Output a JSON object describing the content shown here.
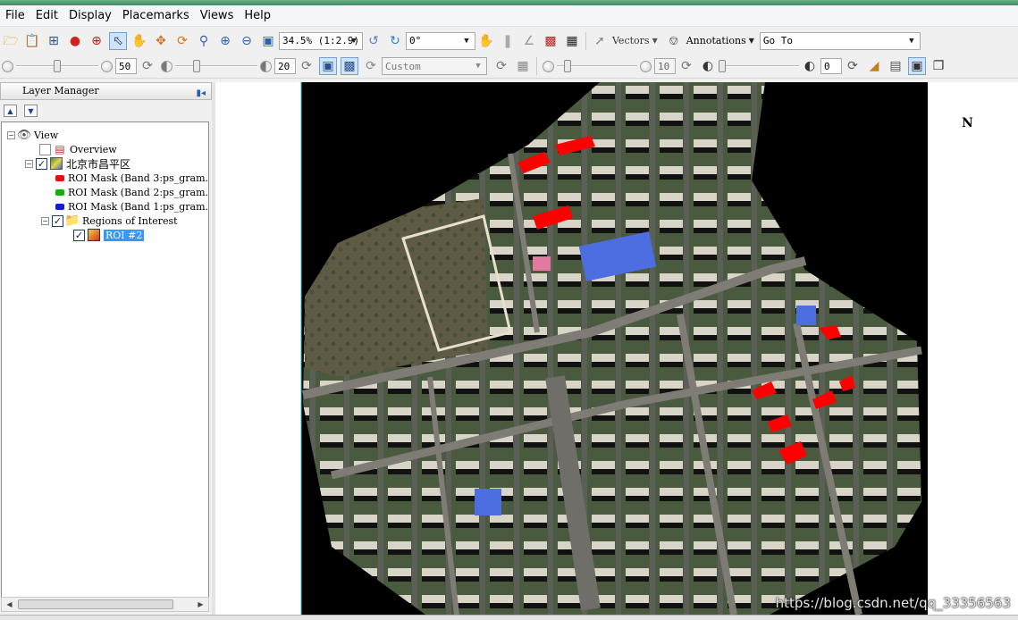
{
  "menu": [
    "File",
    "Edit",
    "Display",
    "Placemarks",
    "Views",
    "Help"
  ],
  "toolbar1": {
    "zoom_value": "34.5% (1:2.9)",
    "rotation_value": "0°",
    "vectors_label": "Vectors",
    "annotations_label": "Annotations",
    "goto_value": "Go To"
  },
  "toolbar2": {
    "brightness_value": "50",
    "contrast_value": "20",
    "stretch_value": "Custom",
    "transparency_value": "0",
    "sharpen_value": "10"
  },
  "layer_manager": {
    "title": "Layer Manager",
    "tree": {
      "view_label": "View",
      "overview_label": "Overview",
      "raster_label": "北京市昌平区",
      "bands": [
        {
          "label": "ROI Mask (Band 3:ps_gram.",
          "color": "#e01010"
        },
        {
          "label": "ROI Mask (Band 2:ps_gram.",
          "color": "#10b010"
        },
        {
          "label": "ROI Mask (Band 1:ps_gram.",
          "color": "#1020d0"
        }
      ],
      "roi_folder_label": "Regions of Interest",
      "roi_item_label": "ROI #2"
    }
  },
  "view": {
    "north_label": "N",
    "watermark": "https://blog.csdn.net/qq_33356563"
  },
  "colors": {
    "roi_fill": "#ff0000",
    "background_nodata": "#000000"
  }
}
